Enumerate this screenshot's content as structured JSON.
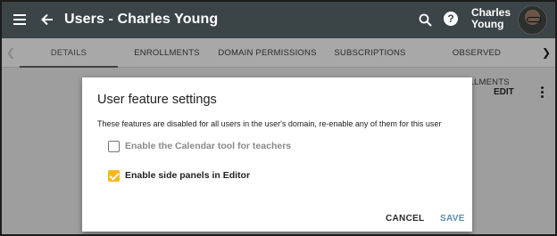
{
  "header": {
    "title": "Users - Charles Young",
    "user_first": "Charles",
    "user_last": "Young"
  },
  "tabs": [
    {
      "label": "DETAILS",
      "active": true
    },
    {
      "label": "ENROLLMENTS",
      "active": false
    },
    {
      "label": "DOMAIN PERMISSIONS",
      "active": false
    },
    {
      "label": "SUBSCRIPTIONS",
      "active": false
    },
    {
      "label": "OBSERVED ENROLLMENTS",
      "active": false
    }
  ],
  "page_actions": {
    "edit_label": "EDIT"
  },
  "dialog": {
    "title": "User feature settings",
    "description": "These features are disabled for all users in the user's domain, re-enable any of them for this user",
    "options": [
      {
        "label": "Enable the Calendar tool for teachers",
        "checked": false
      },
      {
        "label": "Enable side panels in Editor",
        "checked": true
      }
    ],
    "cancel_label": "CANCEL",
    "save_label": "SAVE"
  },
  "colors": {
    "appbar": "#3b4447",
    "checkbox_checked": "#f6b91d",
    "save_button": "#5a8fb0"
  }
}
